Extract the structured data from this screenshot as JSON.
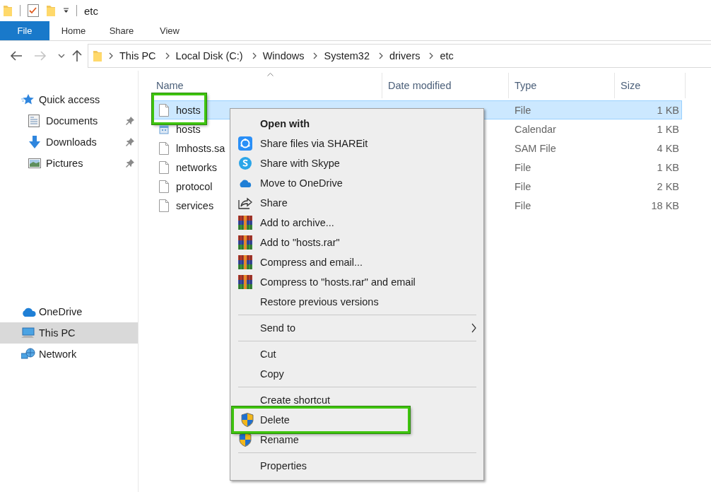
{
  "window": {
    "title": "etc"
  },
  "ribbon_tabs": [
    {
      "label": "File",
      "kind": "file"
    },
    {
      "label": "Home",
      "kind": "tab"
    },
    {
      "label": "Share",
      "kind": "tab"
    },
    {
      "label": "View",
      "kind": "tab"
    }
  ],
  "address": {
    "path": [
      "This PC",
      "Local Disk (C:)",
      "Windows",
      "System32",
      "drivers",
      "etc"
    ]
  },
  "sidebar": {
    "groups": [
      {
        "items": [
          {
            "label": "Quick access",
            "kind": "star",
            "pinned": false,
            "selected": false,
            "indent": false
          },
          {
            "label": "Documents",
            "kind": "documents",
            "pinned": true,
            "selected": false,
            "indent": true
          },
          {
            "label": "Downloads",
            "kind": "downloads",
            "pinned": true,
            "selected": false,
            "indent": true
          },
          {
            "label": "Pictures",
            "kind": "pictures",
            "pinned": true,
            "selected": false,
            "indent": true
          }
        ]
      },
      {
        "items": [
          {
            "label": "OneDrive",
            "kind": "cloud",
            "pinned": false,
            "selected": false,
            "indent": false
          },
          {
            "label": "This PC",
            "kind": "pc",
            "pinned": false,
            "selected": true,
            "indent": false
          },
          {
            "label": "Network",
            "kind": "network",
            "pinned": false,
            "selected": false,
            "indent": false
          }
        ]
      }
    ]
  },
  "file_list": {
    "columns": [
      {
        "label": "Name",
        "sorted": true
      },
      {
        "label": "Date modified",
        "sorted": false
      },
      {
        "label": "Type",
        "sorted": false
      },
      {
        "label": "Size",
        "sorted": false
      }
    ],
    "rows": [
      {
        "name": "hosts",
        "kind": "file",
        "type": "File",
        "size": "1 KB",
        "selected": true,
        "highlighted": true
      },
      {
        "name": "hosts",
        "kind": "calendar",
        "type": "Calendar",
        "size": "1 KB",
        "selected": false,
        "highlighted": false
      },
      {
        "name": "lmhosts.sa",
        "kind": "file",
        "type": "SAM File",
        "size": "4 KB",
        "selected": false,
        "highlighted": false
      },
      {
        "name": "networks",
        "kind": "file",
        "type": "File",
        "size": "1 KB",
        "selected": false,
        "highlighted": false
      },
      {
        "name": "protocol",
        "kind": "file",
        "type": "File",
        "size": "2 KB",
        "selected": false,
        "highlighted": false
      },
      {
        "name": "services",
        "kind": "file",
        "type": "File",
        "size": "18 KB",
        "selected": false,
        "highlighted": false
      }
    ]
  },
  "context_menu": {
    "items": [
      {
        "kind": "header",
        "label": "Open with"
      },
      {
        "kind": "shareit",
        "label": "Share files via SHAREit",
        "highlighted": false
      },
      {
        "kind": "skype",
        "label": "Share with Skype",
        "highlighted": false
      },
      {
        "kind": "onedrive",
        "label": "Move to OneDrive",
        "highlighted": false
      },
      {
        "kind": "share",
        "label": "Share",
        "highlighted": false
      },
      {
        "kind": "archive",
        "label": "Add to archive...",
        "highlighted": false
      },
      {
        "kind": "archive",
        "label": "Add to \"hosts.rar\"",
        "highlighted": false
      },
      {
        "kind": "archive",
        "label": "Compress and email...",
        "highlighted": false
      },
      {
        "kind": "archive",
        "label": "Compress to \"hosts.rar\" and email",
        "highlighted": false
      },
      {
        "kind": "plain",
        "label": "Restore previous versions",
        "highlighted": false
      },
      {
        "kind": "separator"
      },
      {
        "kind": "submenu",
        "label": "Send to",
        "highlighted": false
      },
      {
        "kind": "separator"
      },
      {
        "kind": "plain",
        "label": "Cut",
        "highlighted": false
      },
      {
        "kind": "plain",
        "label": "Copy",
        "highlighted": false
      },
      {
        "kind": "separator"
      },
      {
        "kind": "plain",
        "label": "Create shortcut",
        "highlighted": false
      },
      {
        "kind": "shield",
        "label": "Delete",
        "highlighted": true
      },
      {
        "kind": "shield",
        "label": "Rename",
        "highlighted": false
      },
      {
        "kind": "separator"
      },
      {
        "kind": "plain",
        "label": "Properties",
        "highlighted": false
      }
    ]
  }
}
